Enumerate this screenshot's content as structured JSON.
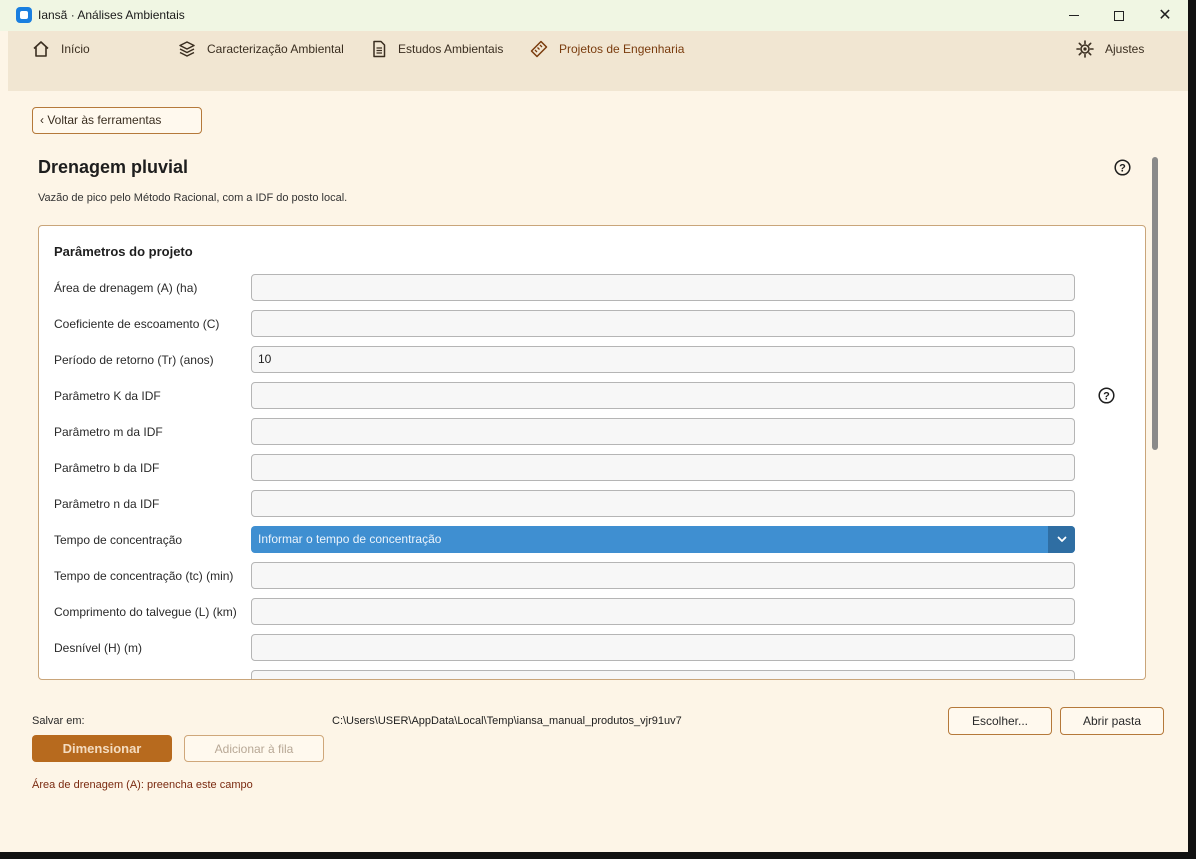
{
  "window": {
    "title": "Iansã · Análises Ambientais"
  },
  "nav": {
    "items": [
      {
        "label": "Início",
        "icon": "home-icon"
      },
      {
        "label": "Caracterização Ambiental",
        "icon": "layers-icon"
      },
      {
        "label": "Estudos Ambientais",
        "icon": "document-icon"
      },
      {
        "label": "Projetos de Engenharia",
        "icon": "ruler-icon",
        "active": true
      }
    ],
    "settings": {
      "label": "Ajustes",
      "icon": "gear-icon"
    }
  },
  "back_button": "‹ Voltar às ferramentas",
  "page": {
    "title": "Drenagem pluvial",
    "subtitle": "Vazão de pico pelo Método Racional, com a IDF do posto local."
  },
  "panel": {
    "title": "Parâmetros do projeto",
    "fields": [
      {
        "label": "Área de drenagem (A) (ha)",
        "value": ""
      },
      {
        "label": "Coeficiente de escoamento (C)",
        "value": ""
      },
      {
        "label": "Período de retorno (Tr) (anos)",
        "value": "10"
      },
      {
        "label": "Parâmetro K da IDF",
        "value": "",
        "help": true
      },
      {
        "label": "Parâmetro m da IDF",
        "value": ""
      },
      {
        "label": "Parâmetro b da IDF",
        "value": ""
      },
      {
        "label": "Parâmetro n da IDF",
        "value": ""
      },
      {
        "label": "Tempo de concentração",
        "select": "Informar o tempo de concentração"
      },
      {
        "label": "Tempo de concentração (tc) (min)",
        "value": ""
      },
      {
        "label": "Comprimento do talvegue (L) (km)",
        "value": ""
      },
      {
        "label": "Desnível (H) (m)",
        "value": ""
      }
    ]
  },
  "footer": {
    "save_label": "Salvar em:",
    "save_path": "C:\\Users\\USER\\AppData\\Local\\Temp\\iansa_manual_produtos_vjr91uv7",
    "choose_button": "Escolher...",
    "open_folder_button": "Abrir pasta",
    "dimension_button": "Dimensionar",
    "queue_button": "Adicionar à fila",
    "error_message": "Área de drenagem (A): preencha este campo"
  },
  "colors": {
    "background": "#fdf5e7",
    "nav_background": "#f1e6d2",
    "accent": "#b76a1e",
    "select_blue": "#3f8fd1",
    "error": "#7a2a10"
  }
}
